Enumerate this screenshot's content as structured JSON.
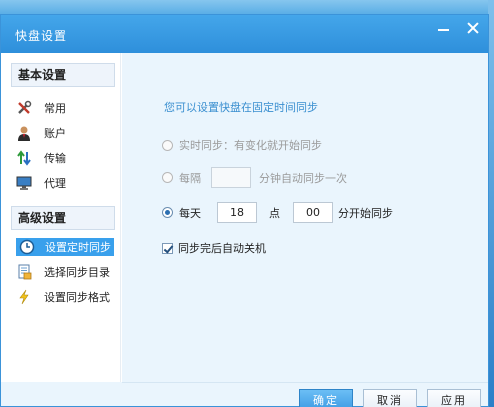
{
  "window": {
    "title": "快盘设置"
  },
  "sidebar": {
    "basic_header": "基本设置",
    "basic_items": [
      {
        "label": "常用",
        "icon": "tools-icon"
      },
      {
        "label": "账户",
        "icon": "user-icon"
      },
      {
        "label": "传输",
        "icon": "transfer-arrows-icon"
      },
      {
        "label": "代理",
        "icon": "monitor-icon"
      }
    ],
    "advanced_header": "高级设置",
    "advanced_items": [
      {
        "label": "设置定时同步",
        "icon": "clock-icon",
        "active": true
      },
      {
        "label": "选择同步目录",
        "icon": "folder-doc-icon"
      },
      {
        "label": "设置同步格式",
        "icon": "lightning-icon"
      }
    ]
  },
  "content": {
    "heading": "您可以设置快盘在固定时间同步",
    "realtime": {
      "label": "实时同步：有变化就开始同步",
      "selected": false,
      "enabled": false
    },
    "interval": {
      "prefix": "每隔",
      "value": "",
      "suffix": "分钟自动同步一次",
      "selected": false,
      "enabled": false
    },
    "daily": {
      "prefix": "每天",
      "hour": "18",
      "mid": "点",
      "minute": "00",
      "suffix": "分开始同步",
      "selected": true
    },
    "shutdown": {
      "label": "同步完后自动关机",
      "checked": true
    }
  },
  "footer": {
    "ok": "确定",
    "cancel": "取消",
    "apply": "应用"
  },
  "colors": {
    "titlebar": "#3a9ae4",
    "accent": "#39a0ec",
    "content_bg": "#eaf5fd",
    "heading": "#3a8fd0"
  }
}
